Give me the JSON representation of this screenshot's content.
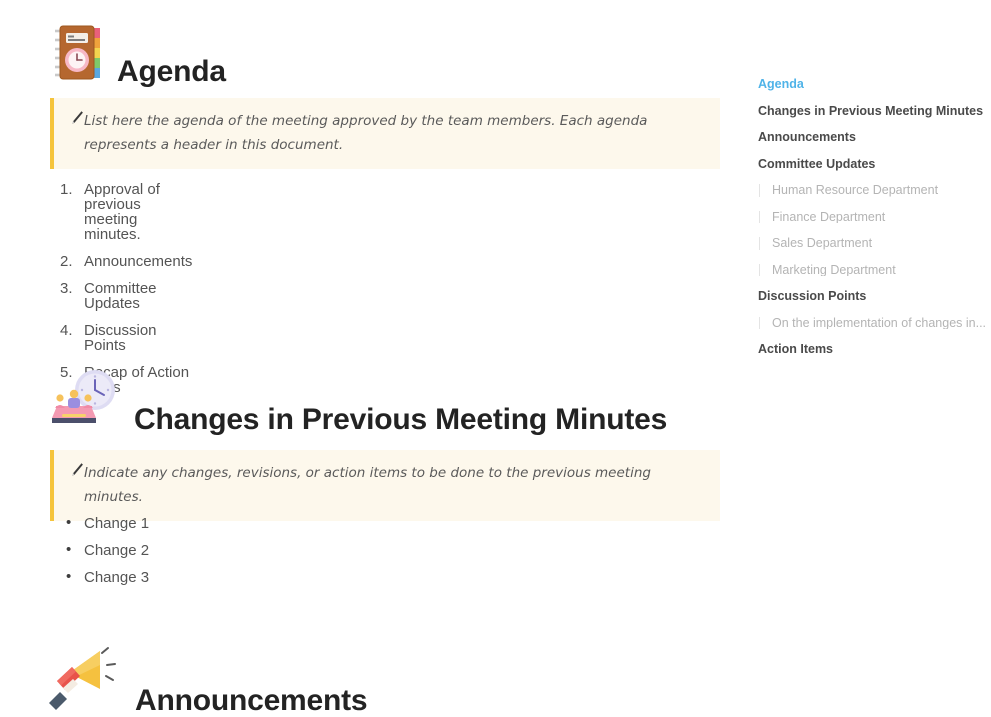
{
  "colors": {
    "accent_blue": "#4fb3e8",
    "callout_border": "#f5c43c",
    "callout_bg": "#fdf8ec",
    "heading": "#232323",
    "body_text": "#545454",
    "toc_text": "#4a4a4a",
    "toc_sub_text": "#b4b4b4"
  },
  "sections": [
    {
      "id": "agenda",
      "icon": "notebook-with-clock-icon",
      "title": "Agenda",
      "callout": {
        "icon": "pen-icon",
        "text": "List here the agenda of the meeting approved by the team members. Each agenda represents a header in this document."
      },
      "list_type": "ordered",
      "items": [
        "Approval of previous meeting minutes.",
        "Announcements",
        "Committee Updates",
        "Discussion Points",
        "Recap of Action Items"
      ]
    },
    {
      "id": "changes",
      "icon": "meeting-with-clock-icon",
      "title": "Changes in Previous Meeting Minutes",
      "callout": {
        "icon": "pen-icon",
        "text": "Indicate any changes, revisions, or action items to be done to the previous meeting minutes."
      },
      "list_type": "bulleted",
      "items": [
        "Change 1",
        "Change 2",
        "Change 3"
      ]
    },
    {
      "id": "announcements",
      "icon": "megaphone-icon",
      "title": "Announcements"
    }
  ],
  "toc": {
    "items": [
      {
        "label": "Agenda",
        "level": 1,
        "active": true
      },
      {
        "label": "Changes in Previous Meeting Minutes",
        "level": 1,
        "active": false
      },
      {
        "label": "Announcements",
        "level": 1,
        "active": false
      },
      {
        "label": "Committee Updates",
        "level": 1,
        "active": false
      },
      {
        "label": "Human Resource Department",
        "level": 2,
        "active": false
      },
      {
        "label": "Finance Department",
        "level": 2,
        "active": false
      },
      {
        "label": "Sales Department",
        "level": 2,
        "active": false
      },
      {
        "label": "Marketing Department",
        "level": 2,
        "active": false,
        "last_of_group": true
      },
      {
        "label": "Discussion Points",
        "level": 1,
        "active": false
      },
      {
        "label": "On the implementation of changes in...",
        "level": 2,
        "active": false,
        "last_of_group": true
      },
      {
        "label": "Action Items",
        "level": 1,
        "active": false
      }
    ]
  }
}
